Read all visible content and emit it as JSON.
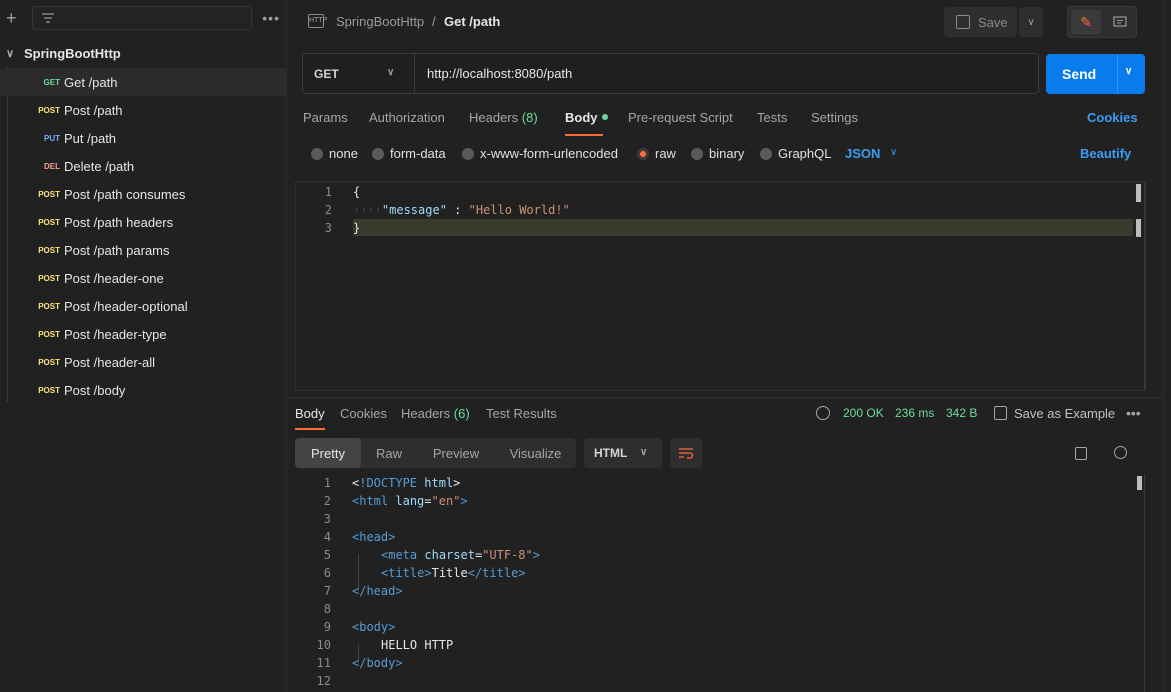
{
  "sidebar": {
    "collection": "SpringBootHttp",
    "items": [
      {
        "method": "GET",
        "label": "Get /path",
        "selected": true
      },
      {
        "method": "POST",
        "label": "Post /path"
      },
      {
        "method": "PUT",
        "label": "Put /path"
      },
      {
        "method": "DEL",
        "label": "Delete /path"
      },
      {
        "method": "POST",
        "label": "Post /path consumes"
      },
      {
        "method": "POST",
        "label": "Post /path headers"
      },
      {
        "method": "POST",
        "label": "Post /path params"
      },
      {
        "method": "POST",
        "label": "Post /header-one"
      },
      {
        "method": "POST",
        "label": "Post /header-optional"
      },
      {
        "method": "POST",
        "label": "Post /header-type"
      },
      {
        "method": "POST",
        "label": "Post /header-all"
      },
      {
        "method": "POST",
        "label": "Post /body"
      }
    ]
  },
  "header": {
    "icon_text": "HTTP",
    "breadcrumb_collection": "SpringBootHttp",
    "breadcrumb_sep": "/",
    "breadcrumb_request": "Get /path",
    "save_label": "Save"
  },
  "request": {
    "method": "GET",
    "url": "http://localhost:8080/path",
    "send_label": "Send",
    "tabs": [
      {
        "label": "Params"
      },
      {
        "label": "Authorization"
      },
      {
        "label": "Headers",
        "count": "(8)"
      },
      {
        "label": "Body",
        "active": true
      },
      {
        "label": "Pre-request Script"
      },
      {
        "label": "Tests"
      },
      {
        "label": "Settings"
      }
    ],
    "cookies_label": "Cookies",
    "body_types": [
      "none",
      "form-data",
      "x-www-form-urlencoded",
      "raw",
      "binary",
      "GraphQL"
    ],
    "body_type_selected": "raw",
    "raw_format": "JSON",
    "beautify_label": "Beautify",
    "body_lines": [
      "1",
      "2",
      "3"
    ],
    "body_code": {
      "open": "{",
      "key": "\"message\"",
      "colon": " : ",
      "value": "\"Hello World!\"",
      "close": "}"
    }
  },
  "response": {
    "tabs": [
      {
        "label": "Body",
        "active": true
      },
      {
        "label": "Cookies"
      },
      {
        "label": "Headers",
        "count": "(6)"
      },
      {
        "label": "Test Results"
      }
    ],
    "status": "200 OK",
    "time": "236 ms",
    "size": "342 B",
    "save_example_label": "Save as Example",
    "views": [
      "Pretty",
      "Raw",
      "Preview",
      "Visualize"
    ],
    "active_view": "Pretty",
    "format": "HTML",
    "line_numbers": [
      "1",
      "2",
      "3",
      "4",
      "5",
      "6",
      "7",
      "8",
      "9",
      "10",
      "11",
      "12"
    ],
    "code": {
      "l1_doctype": "!DOCTYPE",
      "l1_html": "html",
      "l2_tag": "html",
      "l2_attr": "lang",
      "l2_val": "\"en\"",
      "l4_tag": "head",
      "l5_tag": "meta",
      "l5_attr": "charset",
      "l5_val": "\"UTF-8\"",
      "l6_tag": "title",
      "l6_text": "Title",
      "l7_tag": "/head",
      "l9_tag": "body",
      "l10_text": "HELLO HTTP",
      "l11_tag": "/body"
    }
  },
  "colors": {
    "accent": "#ff6c37",
    "send": "#097bed",
    "link": "#3b9cf5",
    "success": "#6bdd9a"
  }
}
